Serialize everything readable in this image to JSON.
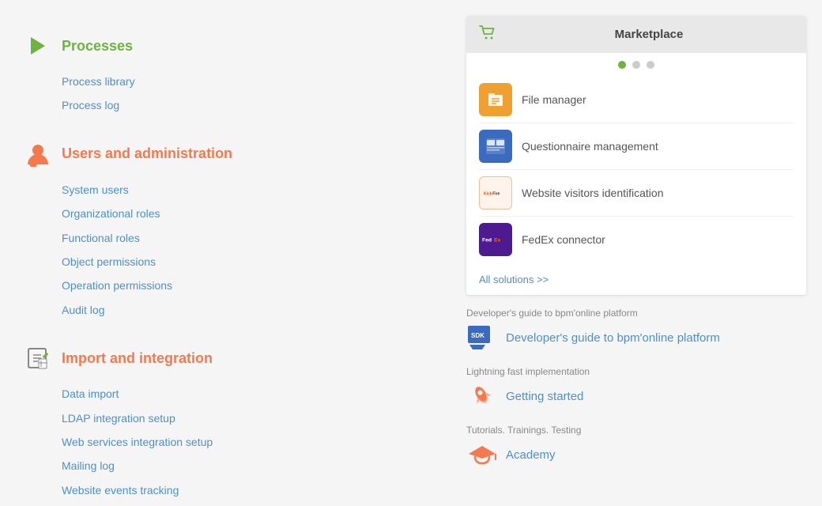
{
  "sidebar": {
    "sections": [
      {
        "id": "processes",
        "title": "Processes",
        "title_color": "green",
        "icon": "play",
        "links": [
          "Process library",
          "Process log"
        ]
      },
      {
        "id": "users",
        "title": "Users and administration",
        "title_color": "orange",
        "icon": "user",
        "links": [
          "System users",
          "Organizational roles",
          "Functional roles",
          "Object permissions",
          "Operation permissions",
          "Audit log"
        ]
      },
      {
        "id": "import",
        "title": "Import and integration",
        "title_color": "orange",
        "icon": "import",
        "links": [
          "Data import",
          "LDAP integration setup",
          "Web services integration setup",
          "Mailing log",
          "Website events tracking"
        ]
      }
    ]
  },
  "marketplace": {
    "header_title": "Marketplace",
    "dots": [
      true,
      false,
      false
    ],
    "items": [
      {
        "id": "file-manager",
        "label": "File manager",
        "icon_type": "file"
      },
      {
        "id": "questionnaire",
        "label": "Questionnaire management",
        "icon_type": "quest"
      },
      {
        "id": "kickfire",
        "label": "Website visitors identification",
        "icon_type": "kick"
      },
      {
        "id": "fedex",
        "label": "FedEx connector",
        "icon_type": "fedex"
      }
    ],
    "all_solutions_label": "All solutions >>"
  },
  "resources": [
    {
      "id": "dev-guide",
      "label": "Developer's guide to bpm'online platform",
      "link_text": "Developer's guide to bpm'online platform",
      "icon_type": "sdk"
    },
    {
      "id": "getting-started",
      "label": "Lightning fast implementation",
      "link_text": "Getting started",
      "icon_type": "rocket"
    },
    {
      "id": "academy",
      "label": "Tutorials. Trainings. Testing",
      "link_text": "Academy",
      "icon_type": "cap"
    }
  ]
}
